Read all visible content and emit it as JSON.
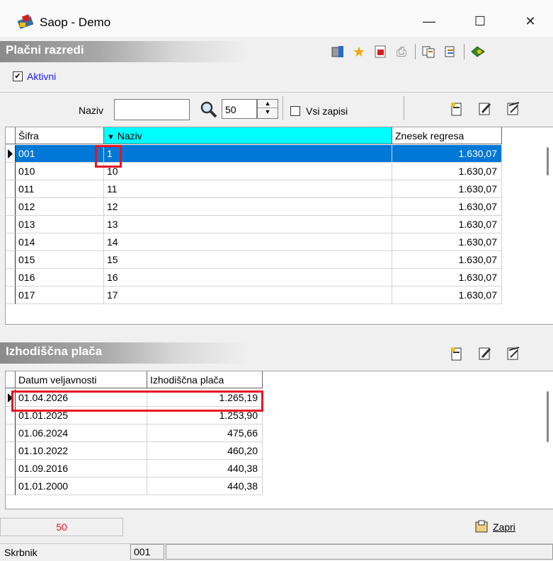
{
  "window": {
    "title": "Saop  - Demo",
    "min": "—",
    "max": "☐",
    "close": "✕"
  },
  "section1": {
    "title": "Plačni razredi"
  },
  "aktivni": {
    "label": "Aktivni",
    "checked": "✔"
  },
  "filter": {
    "naziv_label": "Naziv",
    "naziv_value": "",
    "count_value": "50",
    "vsi_label": "Vsi zapisi"
  },
  "grid1": {
    "headers": [
      "Šifra",
      "Naziv",
      "Znesek regresa"
    ],
    "sort_marker": "▼",
    "rows": [
      {
        "sifra": "001",
        "naziv": "1",
        "znesek": "1.630,07"
      },
      {
        "sifra": "010",
        "naziv": "10",
        "znesek": "1.630,07"
      },
      {
        "sifra": "011",
        "naziv": "11",
        "znesek": "1.630,07"
      },
      {
        "sifra": "012",
        "naziv": "12",
        "znesek": "1.630,07"
      },
      {
        "sifra": "013",
        "naziv": "13",
        "znesek": "1.630,07"
      },
      {
        "sifra": "014",
        "naziv": "14",
        "znesek": "1.630,07"
      },
      {
        "sifra": "015",
        "naziv": "15",
        "znesek": "1.630,07"
      },
      {
        "sifra": "016",
        "naziv": "16",
        "znesek": "1.630,07"
      },
      {
        "sifra": "017",
        "naziv": "17",
        "znesek": "1.630,07"
      }
    ]
  },
  "section2": {
    "title": "Izhodiščna plača"
  },
  "grid2": {
    "headers": [
      "Datum veljavnosti",
      "Izhodiščna plača"
    ],
    "rows": [
      {
        "datum": "01.04.2026",
        "placa": "1.265,19"
      },
      {
        "datum": "01.01.2025",
        "placa": "1.253,90"
      },
      {
        "datum": "01.06.2024",
        "placa": "475,66"
      },
      {
        "datum": "01.10.2022",
        "placa": "460,20"
      },
      {
        "datum": "01.09.2016",
        "placa": "440,38"
      },
      {
        "datum": "01.01.2000",
        "placa": "440,38"
      }
    ]
  },
  "footer": {
    "count": "50",
    "close_label": "Zapri"
  },
  "status": {
    "label": "Skrbnik",
    "value": "001"
  },
  "colors": {
    "selected": "#0078d7",
    "sorted_header": "#00ffff",
    "highlight": "#e81123"
  }
}
